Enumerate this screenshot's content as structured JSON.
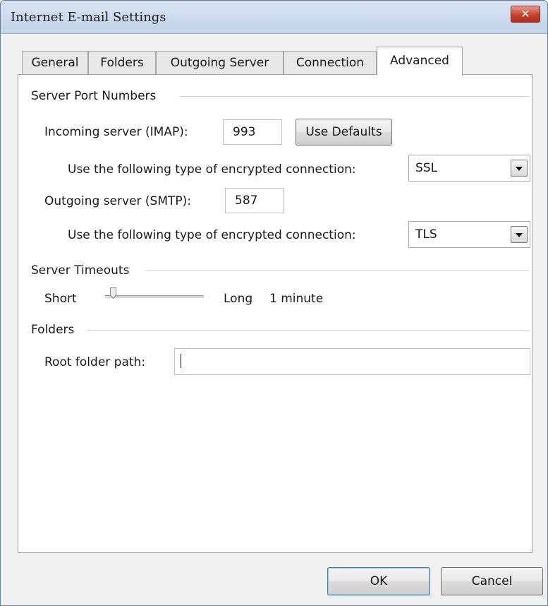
{
  "window": {
    "title": "Internet E-mail Settings",
    "close_glyph": "✕"
  },
  "tabs": [
    {
      "label": "General"
    },
    {
      "label": "Folders"
    },
    {
      "label": "Outgoing Server"
    },
    {
      "label": "Connection"
    },
    {
      "label": "Advanced"
    }
  ],
  "port_numbers": {
    "group_label": "Server Port Numbers",
    "incoming_label": "Incoming server (IMAP):",
    "incoming_value": "993",
    "use_defaults_label": "Use Defaults",
    "incoming_encryption_label": "Use the following type of encrypted connection:",
    "incoming_encryption_value": "SSL",
    "outgoing_label": "Outgoing server (SMTP):",
    "outgoing_value": "587",
    "outgoing_encryption_label": "Use the following type of encrypted connection:",
    "outgoing_encryption_value": "TLS"
  },
  "timeouts": {
    "group_label": "Server Timeouts",
    "short_label": "Short",
    "long_label": "Long",
    "value_text": "1 minute",
    "slider_position": 0.08
  },
  "folders": {
    "group_label": "Folders",
    "root_label": "Root folder path:",
    "root_value": ""
  },
  "footer": {
    "ok_label": "OK",
    "cancel_label": "Cancel"
  }
}
